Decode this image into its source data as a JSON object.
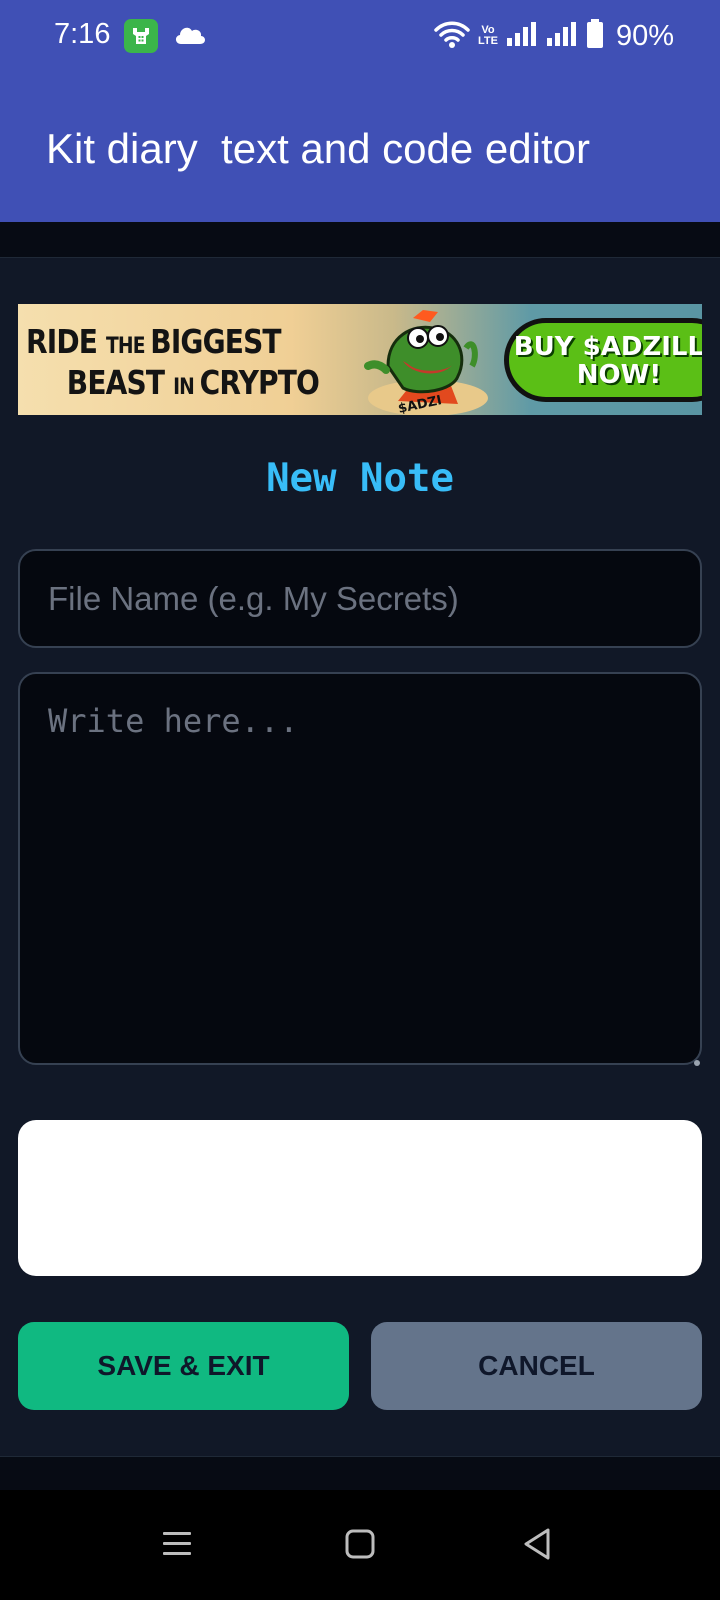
{
  "status_bar": {
    "time": "7:16",
    "network_label_top": "Vo",
    "network_label_bottom": "LTE",
    "battery_percent": "90%",
    "battery_level": 0.9,
    "icons": [
      "app-notification-icon",
      "cloud-icon",
      "wifi-icon",
      "volte-icon",
      "signal-icon",
      "signal-icon",
      "battery-icon"
    ]
  },
  "app_bar": {
    "title": "Kit diary  text and code editor",
    "color": "#4050b5"
  },
  "ad": {
    "line1_a": "RIDE ",
    "line1_b": "THE ",
    "line1_c": "BIGGEST",
    "line2_a": "BEAST ",
    "line2_b": "IN ",
    "line2_c": "CRYPTO",
    "mascot_label": "$ADZI",
    "cta_line1": "BUY $ADZILLA",
    "cta_line2": "NOW!"
  },
  "form": {
    "heading": "New Note",
    "file_name_placeholder": "File Name (e.g. My Secrets)",
    "file_name_value": "",
    "body_placeholder": "Write here...",
    "body_value": ""
  },
  "buttons": {
    "save_label": "SAVE & EXIT",
    "cancel_label": "CANCEL",
    "save_color": "#10b981",
    "cancel_color": "#64748b"
  },
  "accent_color": "#38bdf8",
  "nav": {
    "icons": [
      "recent-apps-icon",
      "home-icon",
      "back-icon"
    ]
  }
}
